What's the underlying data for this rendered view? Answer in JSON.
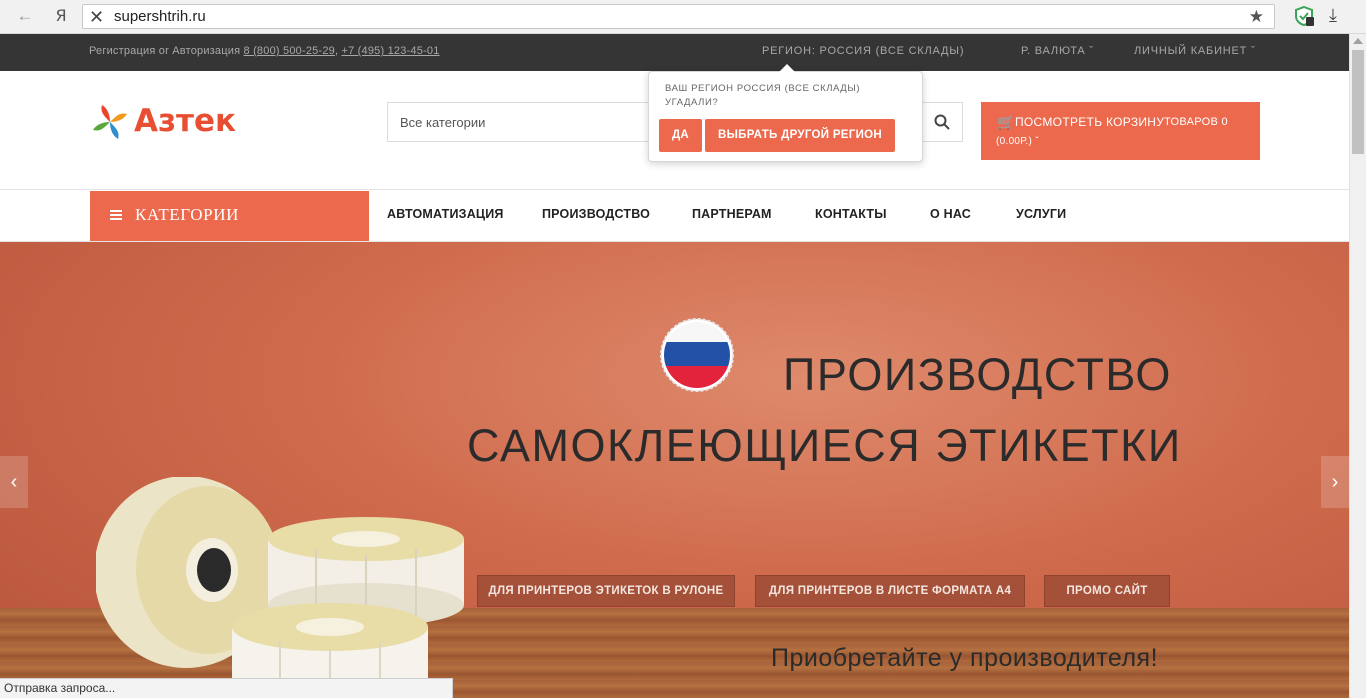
{
  "browser": {
    "yandex_label": "Я",
    "url": "supershtrih.ru"
  },
  "topbar": {
    "register": "Регистрация",
    "or": "or",
    "login": "Авторизация",
    "phone1": "8 (800) 500-25-29",
    "phone2": "+7 (495) 123-45-01",
    "region": "РЕГИОН: РОССИЯ (ВСЕ СКЛАДЫ)",
    "currency": "Р. ВАЛЮТА",
    "cabinet": "ЛИЧНЫЙ КАБИНЕТ"
  },
  "header": {
    "logo_text": "Азтек",
    "search_placeholder": "Все категории",
    "cart_label": "ПОСМОТРЕТЬ КОРЗИНУ",
    "cart_count": "ТОВАРОВ 0",
    "cart_sum": "(0.00Р.)"
  },
  "popup": {
    "message": "ВАШ РЕГИОН РОССИЯ (ВСЕ СКЛАДЫ) УГАДАЛИ?",
    "yes": "ДА",
    "other": "ВЫБРАТЬ ДРУГОЙ РЕГИОН"
  },
  "nav": {
    "categories": "КАТЕГОРИИ",
    "items": [
      "АВТОМАТИЗАЦИЯ",
      "ПРОИЗВОДСТВО",
      "ПАРТНЕРАМ",
      "КОНТАКТЫ",
      "О НАС",
      "УСЛУГИ"
    ]
  },
  "hero": {
    "title1": "ПРОИЗВОДСТВО",
    "title2": "САМОКЛЕЮЩИЕСЯ ЭТИКЕТКИ",
    "buttons": [
      "ДЛЯ ПРИНТЕРОВ ЭТИКЕТОК В РУЛОНЕ",
      "ДЛЯ ПРИНТЕРОВ В ЛИСТЕ ФОРМАТА А4",
      "ПРОМО САЙТ"
    ],
    "tagline": "Приобретайте у производителя!"
  },
  "status_text": "Отправка запроса...",
  "colors": {
    "accent": "#ec694d",
    "topbar": "#353535"
  }
}
